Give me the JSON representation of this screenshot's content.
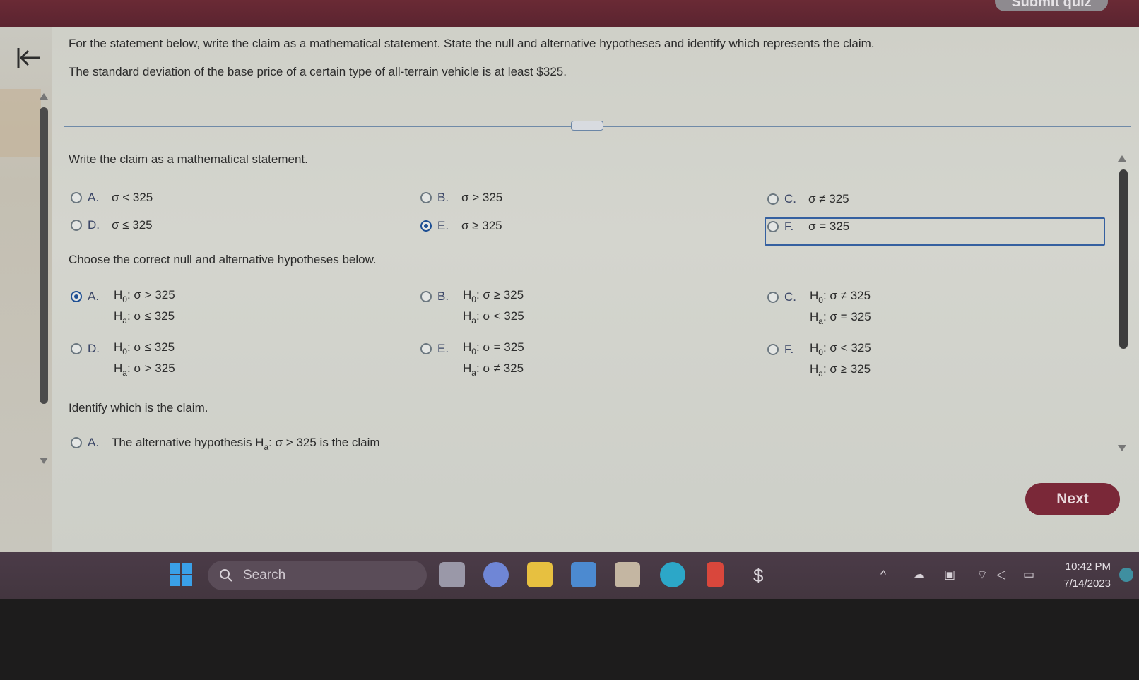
{
  "topbar": {
    "submit_label": "Submit quiz"
  },
  "question": {
    "instruction": "For the statement below, write the claim as a mathematical statement. State the null and alternative hypotheses and identify which represents the claim.",
    "statement": "The standard deviation of the base price of a certain type of all-terrain vehicle is at least $325."
  },
  "part1": {
    "prompt": "Write the claim as a mathematical statement.",
    "options": [
      {
        "letter": "A.",
        "text": "σ < 325",
        "selected": false
      },
      {
        "letter": "B.",
        "text": "σ > 325",
        "selected": false
      },
      {
        "letter": "C.",
        "text": "σ ≠ 325",
        "selected": false
      },
      {
        "letter": "D.",
        "text": "σ ≤ 325",
        "selected": false
      },
      {
        "letter": "E.",
        "text": "σ ≥ 325",
        "selected": true
      },
      {
        "letter": "F.",
        "text": "σ = 325",
        "selected": false
      }
    ]
  },
  "part2": {
    "prompt": "Choose the correct null and alternative hypotheses below.",
    "options": [
      {
        "letter": "A.",
        "h0": "σ > 325",
        "ha": "σ ≤ 325",
        "selected": true
      },
      {
        "letter": "B.",
        "h0": "σ ≥ 325",
        "ha": "σ < 325",
        "selected": false
      },
      {
        "letter": "C.",
        "h0": "σ ≠ 325",
        "ha": "σ = 325",
        "selected": false
      },
      {
        "letter": "D.",
        "h0": "σ ≤ 325",
        "ha": "σ > 325",
        "selected": false
      },
      {
        "letter": "E.",
        "h0": "σ = 325",
        "ha": "σ ≠ 325",
        "selected": false
      },
      {
        "letter": "F.",
        "h0": "σ < 325",
        "ha": "σ ≥ 325",
        "selected": false
      }
    ],
    "h_label": "H",
    "h0_sub": "0",
    "ha_sub": "a"
  },
  "part3": {
    "prompt": "Identify which is the claim.",
    "optionA": {
      "letter": "A.",
      "pre": "The alternative hypothesis H",
      "sub": "a",
      "post": ": σ > 325 is the claim"
    }
  },
  "nav": {
    "next_label": "Next"
  },
  "taskbar": {
    "search_placeholder": "Search",
    "time": "10:42 PM",
    "date": "7/14/2023"
  },
  "icons": {
    "back": "back-to-start-icon",
    "start": "windows-start-icon",
    "search": "search-icon"
  },
  "colors": {
    "topbar": "#5b2430",
    "accent_blue": "#1e4f93",
    "next_button": "#7a2838",
    "taskbar": "#43363f"
  }
}
